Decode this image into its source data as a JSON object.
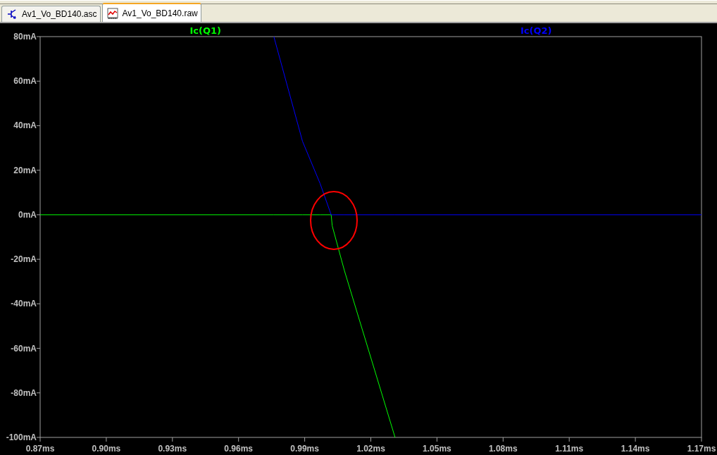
{
  "tabs": [
    {
      "label": "Av1_Vo_BD140.asc",
      "kind": "schematic",
      "selected": false
    },
    {
      "label": "Av1_Vo_BD140.raw",
      "kind": "waveform",
      "selected": true
    }
  ],
  "plot": {
    "chart_data": {
      "type": "line",
      "x": [
        0.87,
        0.976,
        0.989,
        0.997,
        1.002,
        1.0025,
        1.008,
        1.031,
        1.17
      ],
      "series": [
        {
          "name": "Ic(Q1)",
          "color": "#00ff00",
          "values": [
            0,
            0,
            0,
            0,
            0,
            -5,
            -25,
            -100,
            null
          ]
        },
        {
          "name": "Ic(Q2)",
          "color": "#0000ff",
          "values": [
            null,
            80,
            33,
            14,
            0,
            0,
            0,
            0,
            0
          ]
        }
      ],
      "xlim": [
        0.87,
        1.17
      ],
      "ylim": [
        -100,
        80
      ],
      "xticks": [
        {
          "value": 0.87,
          "label": "0.87ms"
        },
        {
          "value": 0.9,
          "label": "0.90ms"
        },
        {
          "value": 0.93,
          "label": "0.93ms"
        },
        {
          "value": 0.96,
          "label": "0.96ms"
        },
        {
          "value": 0.99,
          "label": "0.99ms"
        },
        {
          "value": 1.02,
          "label": "1.02ms"
        },
        {
          "value": 1.05,
          "label": "1.05ms"
        },
        {
          "value": 1.08,
          "label": "1.08ms"
        },
        {
          "value": 1.11,
          "label": "1.11ms"
        },
        {
          "value": 1.14,
          "label": "1.14ms"
        },
        {
          "value": 1.17,
          "label": "1.17ms"
        }
      ],
      "yticks": [
        {
          "value": 80,
          "label": "80mA"
        },
        {
          "value": 60,
          "label": "60mA"
        },
        {
          "value": 40,
          "label": "40mA"
        },
        {
          "value": 20,
          "label": "20mA"
        },
        {
          "value": 0,
          "label": "0mA"
        },
        {
          "value": -20,
          "label": "-20mA"
        },
        {
          "value": -40,
          "label": "-40mA"
        },
        {
          "value": -60,
          "label": "-60mA"
        },
        {
          "value": -80,
          "label": "-80mA"
        },
        {
          "value": -100,
          "label": "-100mA"
        }
      ]
    }
  }
}
